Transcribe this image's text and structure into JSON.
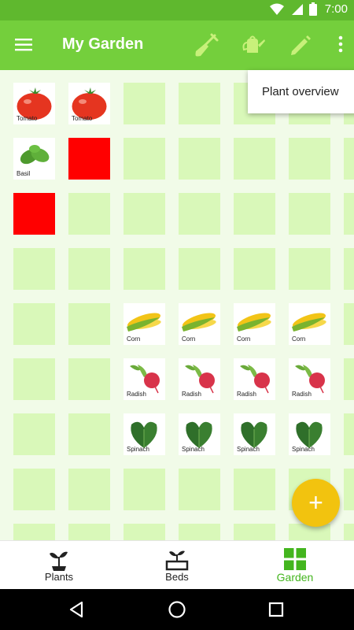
{
  "status_bar": {
    "time": "7:00"
  },
  "app_bar": {
    "title": "My Garden"
  },
  "popup_menu": {
    "items": [
      {
        "label": "Plant overview"
      }
    ]
  },
  "plants": {
    "tomato": {
      "label": "Tomato"
    },
    "basil": {
      "label": "Basil"
    },
    "corn": {
      "label": "Corn"
    },
    "radish": {
      "label": "Radish"
    },
    "spinach": {
      "label": "Spinach"
    }
  },
  "bottom_nav": {
    "items": [
      {
        "label": "Plants",
        "icon": "plant-sprout-icon",
        "active": false
      },
      {
        "label": "Beds",
        "icon": "bed-sprout-icon",
        "active": false
      },
      {
        "label": "Garden",
        "icon": "grid-icon",
        "active": true
      }
    ]
  },
  "colors": {
    "status_bar": "#5fb82e",
    "app_bar": "#74cf3c",
    "grid_bg": "#f1fbe8",
    "empty_cell": "#d9f8b9",
    "red_cell": "#ff0000",
    "fab": "#f2c30f",
    "active_nav": "#43b51e"
  }
}
